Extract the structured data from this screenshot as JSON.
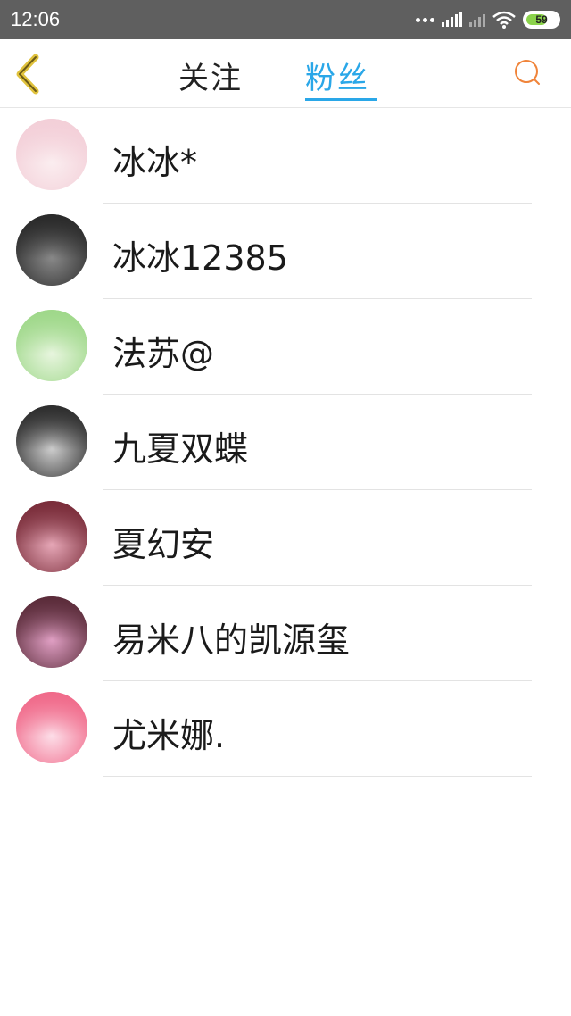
{
  "status_bar": {
    "time": "12:06",
    "battery_level": "59"
  },
  "nav": {
    "tab_following": "关注",
    "tab_fans": "粉丝",
    "active_tab": "粉丝",
    "accent_color": "#2aa7e8",
    "back_icon": "chevron-left-icon",
    "search_icon": "search-icon"
  },
  "fans": [
    {
      "name": "冰冰*",
      "avatar_colors": [
        "#f3cfd8",
        "#fbeef0"
      ]
    },
    {
      "name": "冰冰12385",
      "avatar_colors": [
        "#2a2a2a",
        "#8a8a8a"
      ]
    },
    {
      "name": "法苏@",
      "avatar_colors": [
        "#9fd88a",
        "#e9f6e0"
      ]
    },
    {
      "name": "九夏双蝶",
      "avatar_colors": [
        "#2e2e2e",
        "#cfcfcf"
      ]
    },
    {
      "name": "夏幻安",
      "avatar_colors": [
        "#7a2d3a",
        "#e8a9b9"
      ]
    },
    {
      "name": "易米八的凯源玺",
      "avatar_colors": [
        "#5b2c3a",
        "#e2a1c6"
      ]
    },
    {
      "name": "尤米娜.",
      "avatar_colors": [
        "#f06a8a",
        "#fde0ea"
      ]
    }
  ]
}
